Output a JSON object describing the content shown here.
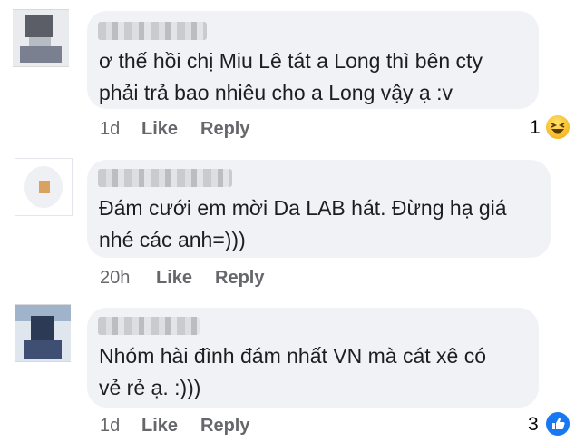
{
  "comments": [
    {
      "text_line1": "ơ thế hồi chị Miu Lê tát a Long thì bên cty",
      "text_line2": "phải trả bao nhiêu cho a Long vậy ạ :v",
      "time": "1d",
      "like_label": "Like",
      "reply_label": "Reply",
      "reaction_count": "1",
      "reaction_icon": "haha-icon"
    },
    {
      "text_line1": "Đám cưới em mời Da LAB hát. Đừng hạ giá",
      "text_line2": "nhé các anh=)))",
      "time": "20h",
      "like_label": "Like",
      "reply_label": "Reply"
    },
    {
      "text_line1": "Nhóm hài đình đám nhất VN mà cát xê có",
      "text_line2": "vẻ rẻ ạ. :)))",
      "time": "1d",
      "like_label": "Like",
      "reply_label": "Reply",
      "reaction_count": "3",
      "reaction_icon": "like-icon"
    }
  ],
  "colors": {
    "bubble": "#f0f2f5",
    "action_text": "#65676b",
    "like_blue": "#1877f2",
    "haha_yellow": "#f7b928"
  }
}
